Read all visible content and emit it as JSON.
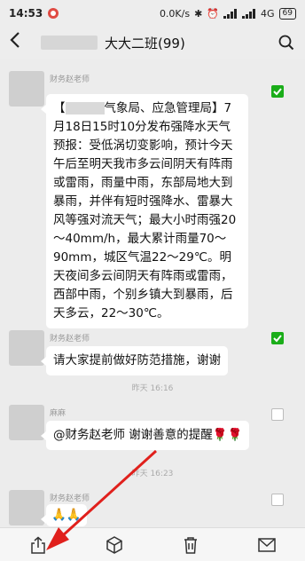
{
  "status_bar": {
    "time": "14:53",
    "network_speed": "0.0K/s",
    "network_type": "4G",
    "battery": "69"
  },
  "header": {
    "title": "大大二班(99)"
  },
  "messages": [
    {
      "sender": "财务赵老师",
      "text_prefix": "【",
      "text": "气象局、应急管理局】7月18日15时10分发布强降水天气预报：受低涡切变影响，预计今天午后至明天我市多云间阴天有阵雨或雷雨，雨量中雨，东部局地大到暴雨，并伴有短时强降水、雷暴大风等强对流天气；最大小时雨强20～40mm/h，最大累计雨量70～90mm，城区气温22～29℃。明天夜间多云间阴天有阵雨或雷雨，西部中雨，个别乡镇大到暴雨，后天多云，22～30℃。",
      "checked": true
    },
    {
      "sender": "财务赵老师",
      "text": "请大家提前做好防范措施，谢谢",
      "checked": true
    },
    {
      "sender": "麻麻",
      "text": "@财务赵老师  谢谢善意的提醒🌹🌹",
      "checked": false
    },
    {
      "sender": "财务赵老师",
      "text": "🙏🙏",
      "checked": false
    }
  ],
  "timestamps": [
    "昨天 16:16",
    "昨天 16:23"
  ],
  "toolbar": {
    "items": [
      "share-icon",
      "favorite-icon",
      "delete-icon",
      "mail-icon"
    ]
  },
  "colors": {
    "accent_green": "#1aad19",
    "arrow_red": "#e0201c"
  }
}
